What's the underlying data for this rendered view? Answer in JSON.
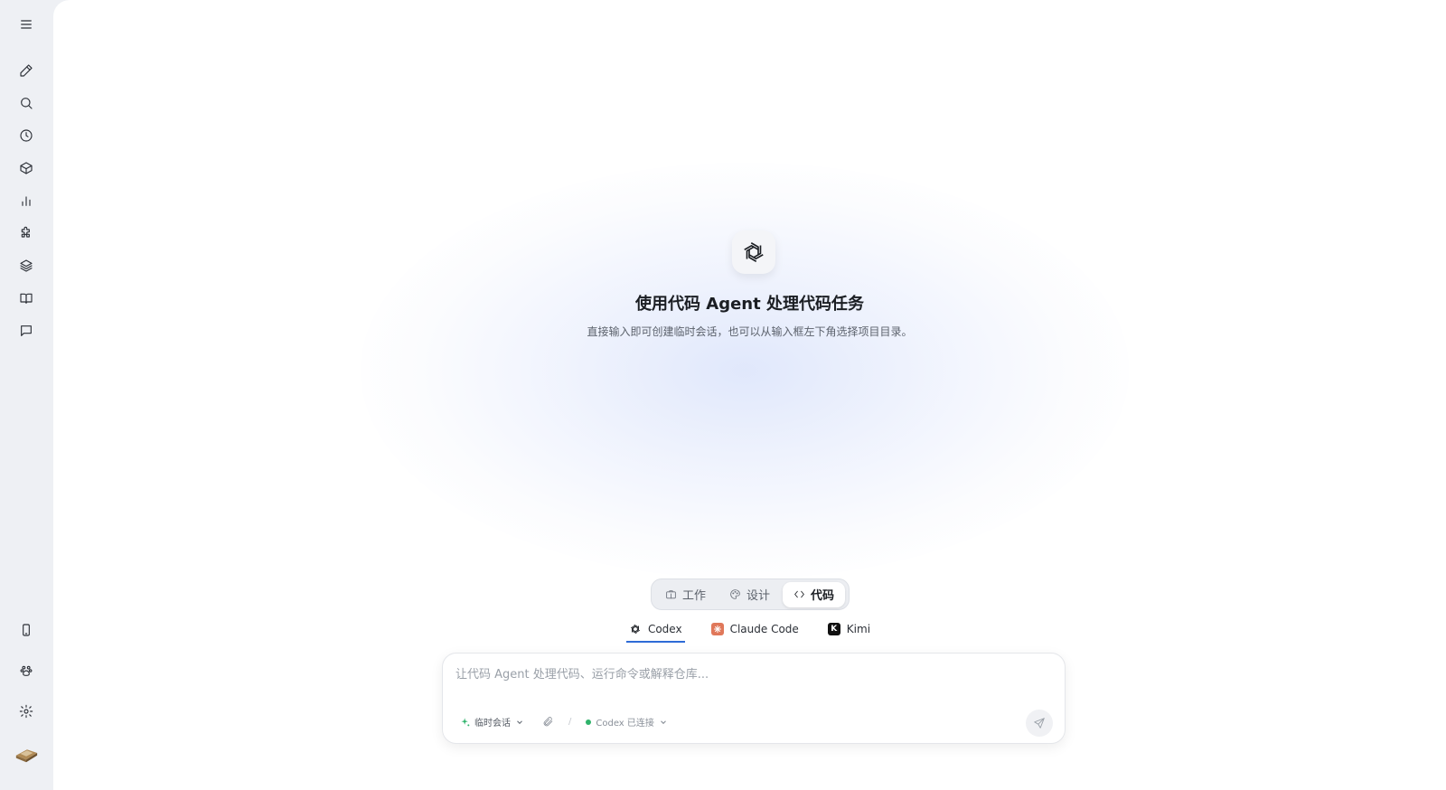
{
  "sidebar": {
    "top_items": [
      {
        "name": "menu-icon"
      },
      {
        "name": "new-chat-icon"
      },
      {
        "name": "search-icon"
      },
      {
        "name": "history-icon"
      },
      {
        "name": "package-icon"
      },
      {
        "name": "chart-icon"
      },
      {
        "name": "plugin-icon"
      },
      {
        "name": "layers-icon"
      },
      {
        "name": "book-icon"
      },
      {
        "name": "message-icon"
      }
    ],
    "bottom_items": [
      {
        "name": "phone-icon"
      },
      {
        "name": "paw-icon"
      },
      {
        "name": "settings-icon"
      },
      {
        "name": "avatar"
      }
    ]
  },
  "hero": {
    "icon": "openai-logo-icon",
    "title": "使用代码 Agent 处理代码任务",
    "subtitle": "直接输入即可创建临时会话，也可以从输入框左下角选择项目目录。"
  },
  "modes": [
    {
      "label": "工作",
      "icon": "briefcase-icon",
      "active": false
    },
    {
      "label": "设计",
      "icon": "palette-icon",
      "active": false
    },
    {
      "label": "代码",
      "icon": "code-icon",
      "active": true
    }
  ],
  "agents": [
    {
      "label": "Codex",
      "icon": "openai-logo-icon",
      "active": true
    },
    {
      "label": "Claude Code",
      "icon": "claude-icon",
      "active": false
    },
    {
      "label": "Kimi",
      "icon": "kimi-icon",
      "active": false
    }
  ],
  "composer": {
    "placeholder": "让代码 Agent 处理代码、运行命令或解释仓库...",
    "session_label": "临时会话",
    "separator": "/",
    "status_label": "Codex 已连接",
    "status_color": "#2fb36b"
  }
}
